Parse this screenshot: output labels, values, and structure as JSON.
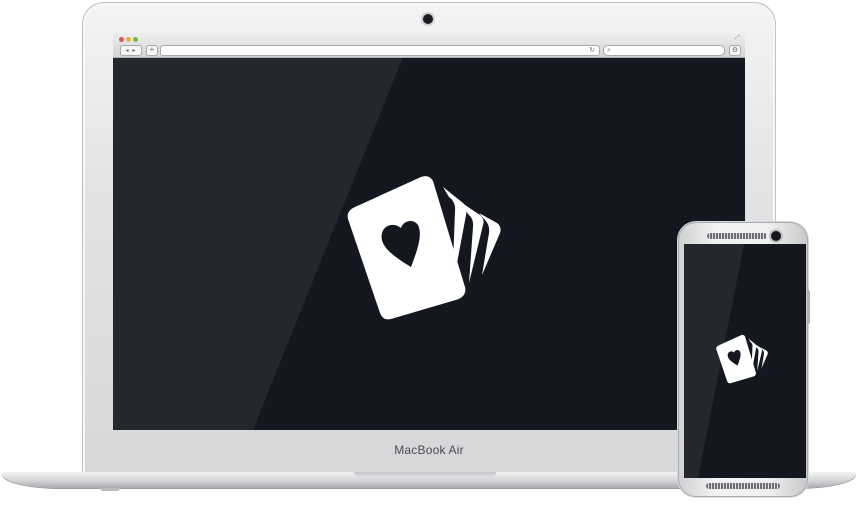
{
  "laptop": {
    "model_label": "MacBook Air",
    "browser": {
      "nav_label": "◂ ▸",
      "add_tab_label": "+",
      "reload_glyph": "↻",
      "search_glyph": "⌕",
      "settings_glyph": "⚙",
      "fullscreen_glyph": "⤢"
    },
    "screen_color": "#14171f",
    "logo_icon": "playing-cards-heart-icon"
  },
  "phone": {
    "screen_color": "#14171f",
    "logo_icon": "playing-cards-heart-icon"
  },
  "colors": {
    "logo": "#ffffff",
    "device_silver": "#e2e3e5"
  }
}
